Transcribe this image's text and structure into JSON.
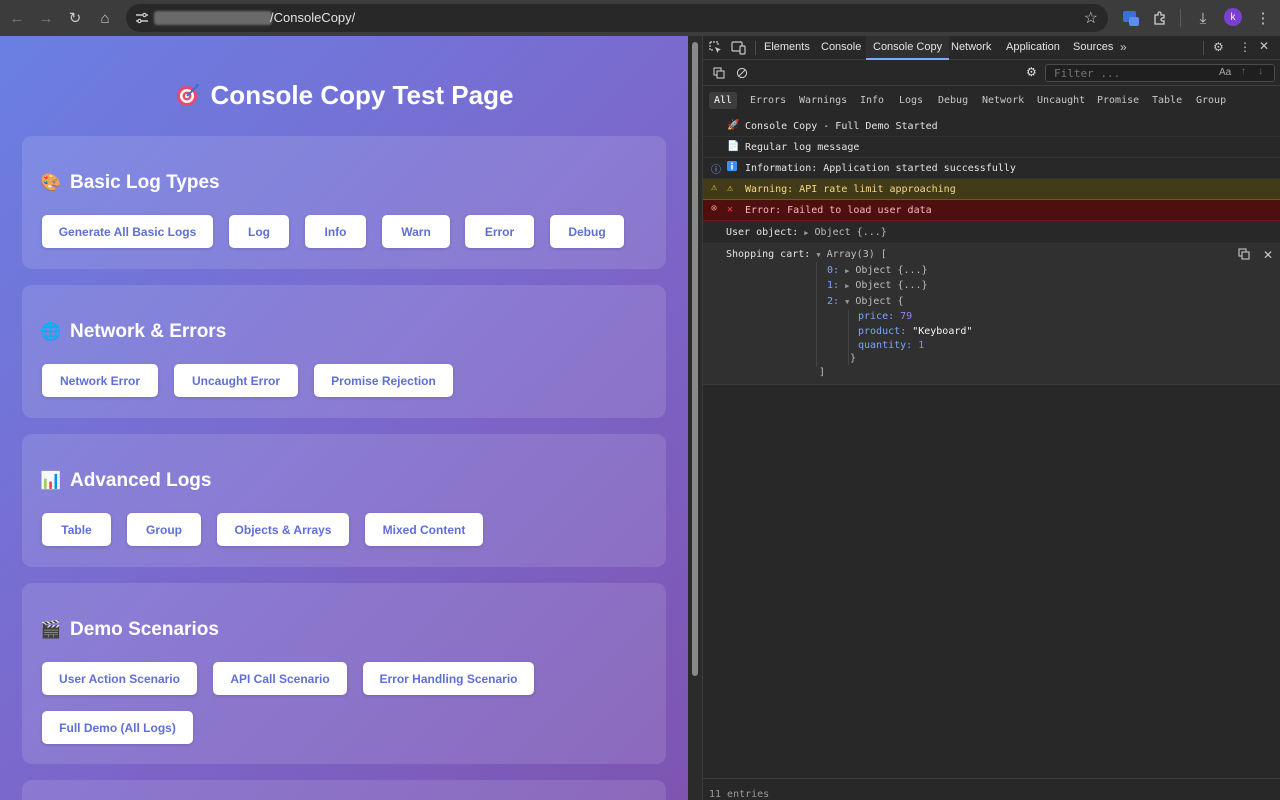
{
  "browser": {
    "url_path": "/ConsoleCopy/",
    "avatar_letter": "k"
  },
  "page": {
    "title": "Console Copy Test Page",
    "sections": [
      {
        "title": "Basic Log Types",
        "buttons": [
          "Generate All Basic Logs",
          "Log",
          "Info",
          "Warn",
          "Error",
          "Debug"
        ]
      },
      {
        "title": "Network & Errors",
        "buttons": [
          "Network Error",
          "Uncaught Error",
          "Promise Rejection"
        ]
      },
      {
        "title": "Advanced Logs",
        "buttons": [
          "Table",
          "Group",
          "Objects & Arrays",
          "Mixed Content"
        ]
      },
      {
        "title": "Demo Scenarios",
        "buttons": [
          "User Action Scenario",
          "API Call Scenario",
          "Error Handling Scenario",
          "Full Demo (All Logs)"
        ]
      }
    ]
  },
  "devtools": {
    "tabs": [
      "Elements",
      "Console",
      "Console Copy",
      "Network",
      "Application",
      "Sources"
    ],
    "active_tab": "Console Copy",
    "filter_placeholder": "Filter ...",
    "filter_case": "Aa",
    "levels": [
      "All",
      "Errors",
      "Warnings",
      "Info",
      "Logs",
      "Debug",
      "Network",
      "Uncaught",
      "Promise",
      "Table",
      "Group"
    ],
    "active_level": "All",
    "logs": [
      {
        "type": "log",
        "text": "Console Copy - Full Demo Started"
      },
      {
        "type": "log",
        "text": "Regular log message"
      },
      {
        "type": "info",
        "text": "Information: Application started successfully"
      },
      {
        "type": "warn",
        "text": "Warning: API rate limit approaching"
      },
      {
        "type": "error",
        "text": "Error: Failed to load user data"
      }
    ],
    "user_object": {
      "label": "User object:",
      "preview": "Object {...}"
    },
    "cart": {
      "label": "Shopping cart:",
      "preview": "Array(3) [",
      "items": [
        {
          "index": "0:",
          "preview": "Object {...}"
        },
        {
          "index": "1:",
          "preview": "Object {...}"
        },
        {
          "index": "2:",
          "preview": "Object {"
        }
      ],
      "expanded": {
        "price_key": "price:",
        "price": "79",
        "product_key": "product:",
        "product": "\"Keyboard\"",
        "quantity_key": "quantity:",
        "quantity": "1"
      },
      "close_obj": "}",
      "close_arr": "]"
    },
    "status": "11 entries"
  }
}
